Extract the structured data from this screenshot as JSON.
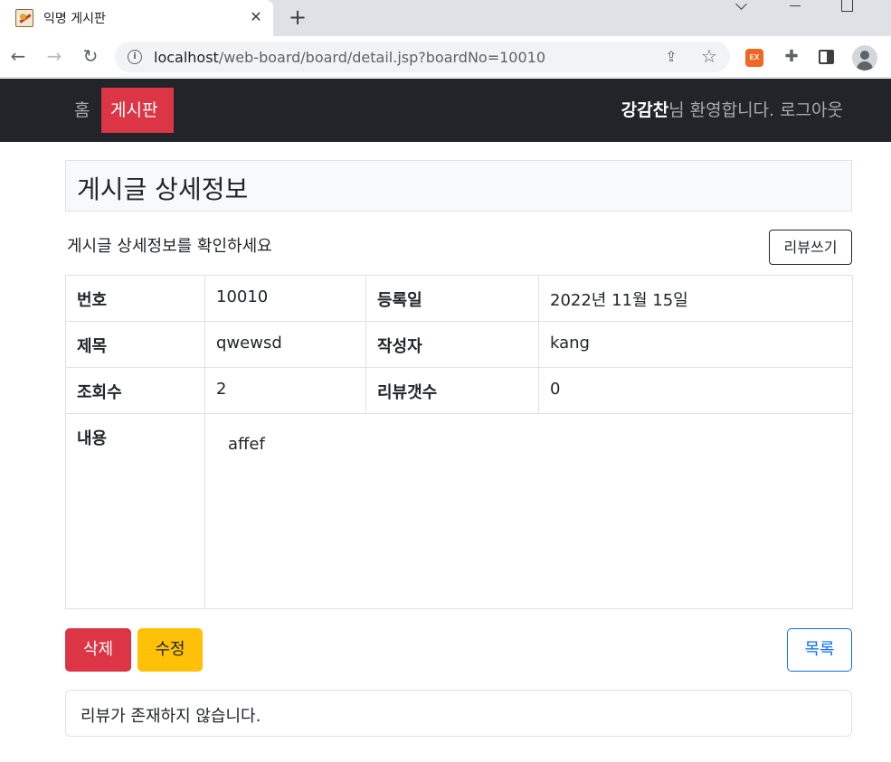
{
  "browser": {
    "tab_title": "익명 게시판",
    "url_host": "localhost",
    "url_path": "/web-board/board/detail.jsp?boardNo=10010",
    "extension_badge": "EX"
  },
  "navbar": {
    "home_label": "홈",
    "board_label": "게시판",
    "user_name": "강감찬",
    "welcome_text": "님 환영합니다.",
    "logout_label": "로그아웃",
    "active_color": "#dc3545"
  },
  "main": {
    "title": "게시글 상세정보",
    "subtitle": "게시글 상세정보를 확인하세요",
    "review_write_label": "리뷰쓰기",
    "table": {
      "no_label": "번호",
      "no_value": "10010",
      "created_label": "등록일",
      "created_value": "2022년 11월 15일",
      "title_label": "제목",
      "title_value": "qwewsd",
      "writer_label": "작성자",
      "writer_value": "kang",
      "views_label": "조회수",
      "views_value": "2",
      "review_count_label": "리뷰갯수",
      "review_count_value": "0",
      "content_label": "내용",
      "content_value": "affef"
    },
    "buttons": {
      "delete_label": "삭제",
      "edit_label": "수정",
      "list_label": "목록"
    },
    "reviews": {
      "empty_text": "리뷰가 존재하지 않습니다."
    }
  }
}
